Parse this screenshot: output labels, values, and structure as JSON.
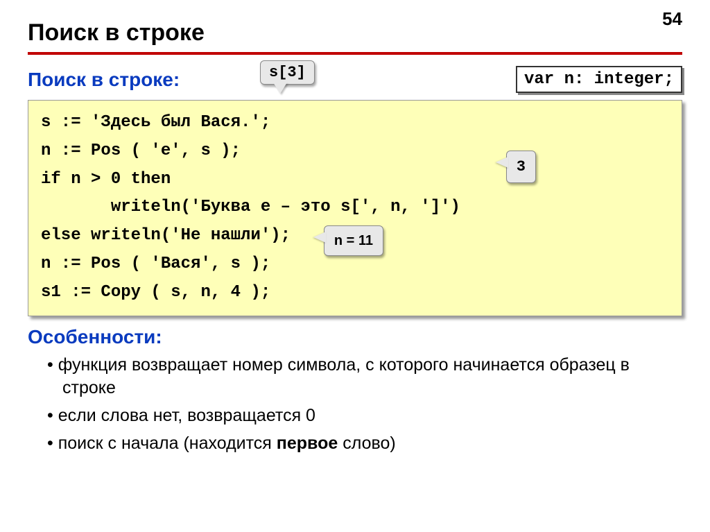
{
  "page_number": "54",
  "title": "Поиск в строке",
  "section1_header": "Поиск в строке:",
  "callout_s3": "s[3]",
  "var_decl": "var n: integer;",
  "code": {
    "l1": "s := 'Здесь был Вася.';",
    "l2": "n := Pos ( 'е', s );",
    "l3": "if n > 0 then",
    "l4": "       writeln('Буква е – это s[', n, ']')",
    "l5": "else writeln('Не нашли');",
    "l6": "n := Pos ( 'Вася', s );",
    "l7": "s1 := Copy ( s, n, 4 );"
  },
  "callout_3": "3",
  "callout_n11": "n = 11",
  "section2_header": "Особенности:",
  "bullets": {
    "b1": "функция возвращает номер символа, с которого начинается образец в строке",
    "b2": "если слова нет, возвращается 0",
    "b3_pre": "поиск с начала (находится ",
    "b3_bold": "первое",
    "b3_post": " слово)"
  }
}
